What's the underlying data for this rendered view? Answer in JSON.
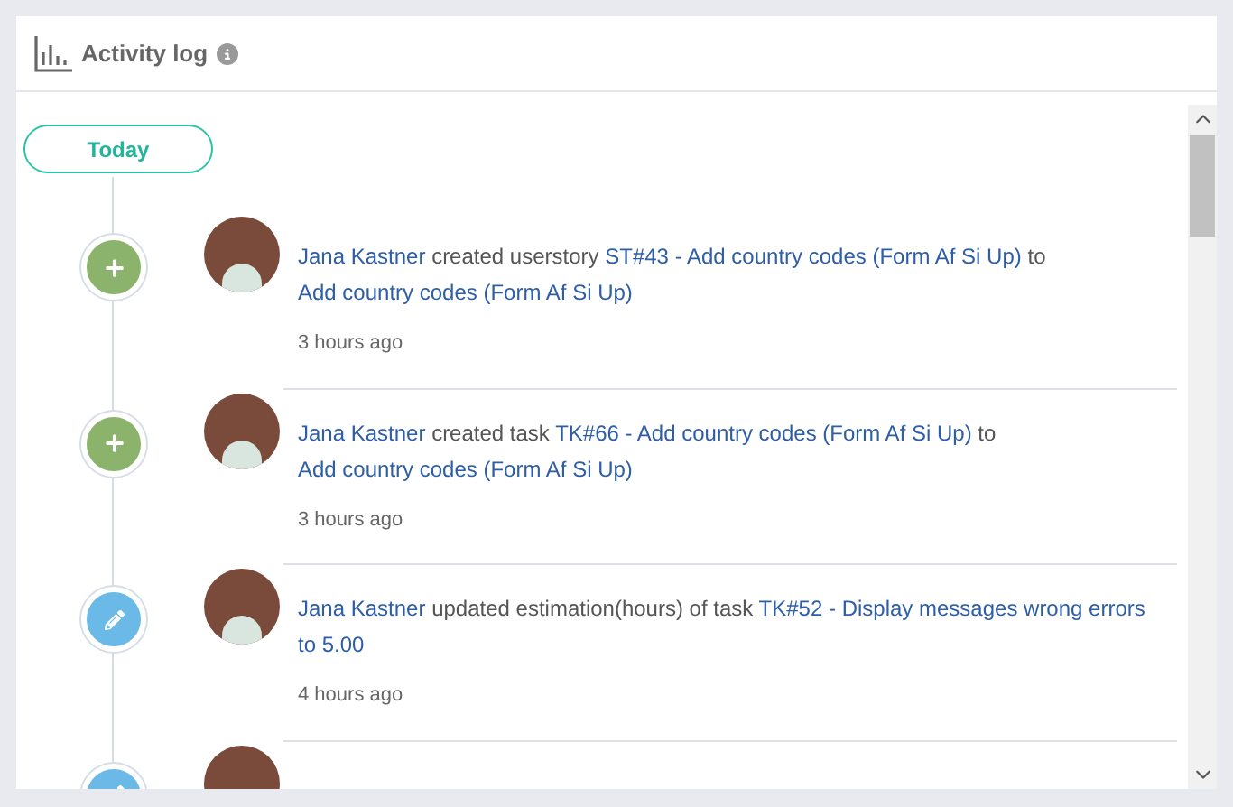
{
  "panel": {
    "title": "Activity log"
  },
  "group": {
    "label": "Today"
  },
  "entries": [
    {
      "kind": "create",
      "parts": [
        {
          "kind": "link",
          "text": "Jana Kastner"
        },
        {
          "kind": "text",
          "text": "created userstory"
        },
        {
          "kind": "link",
          "text": "ST#43 - Add country codes (Form Af Si Up)"
        },
        {
          "kind": "text",
          "text": "to"
        },
        {
          "kind": "link",
          "text": "Add country codes (Form Af Si Up)"
        }
      ],
      "time": "3 hours ago"
    },
    {
      "kind": "create",
      "parts": [
        {
          "kind": "link",
          "text": "Jana Kastner"
        },
        {
          "kind": "text",
          "text": "created task"
        },
        {
          "kind": "link",
          "text": "TK#66 - Add country codes (Form Af Si Up)"
        },
        {
          "kind": "text",
          "text": "to"
        },
        {
          "kind": "link",
          "text": "Add country codes (Form Af Si Up)"
        }
      ],
      "time": "3 hours ago"
    },
    {
      "kind": "edit",
      "parts": [
        {
          "kind": "link",
          "text": "Jana Kastner"
        },
        {
          "kind": "text",
          "text": "updated estimation(hours) of task"
        },
        {
          "kind": "link",
          "text": "TK#52 - Display messages wrong errors"
        },
        {
          "kind": "link",
          "text": "to 5.00"
        }
      ],
      "time": "4 hours ago"
    },
    {
      "kind": "edit"
    }
  ]
}
